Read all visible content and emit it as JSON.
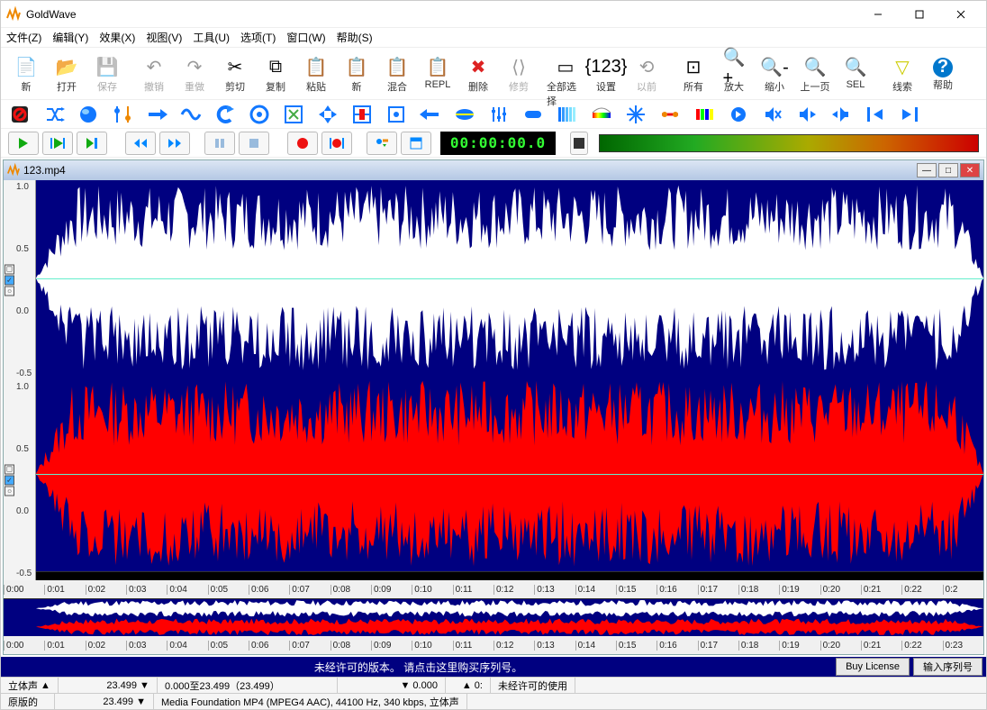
{
  "app": {
    "title": "GoldWave"
  },
  "menu": [
    "文件(Z)",
    "编辑(Y)",
    "效果(X)",
    "视图(V)",
    "工具(U)",
    "选项(T)",
    "窗口(W)",
    "帮助(S)"
  ],
  "toolbar_main": [
    {
      "icon": "new-icon",
      "label": "新"
    },
    {
      "icon": "open-icon",
      "label": "打开"
    },
    {
      "icon": "save-icon",
      "label": "保存",
      "disabled": true
    },
    {
      "sep": true
    },
    {
      "icon": "undo-icon",
      "label": "撤销",
      "disabled": true
    },
    {
      "icon": "redo-icon",
      "label": "重做",
      "disabled": true
    },
    {
      "icon": "cut-icon",
      "label": "剪切"
    },
    {
      "icon": "copy-icon",
      "label": "复制"
    },
    {
      "icon": "paste-icon",
      "label": "粘贴"
    },
    {
      "icon": "pastenew-icon",
      "label": "新"
    },
    {
      "icon": "mix-icon",
      "label": "混合"
    },
    {
      "icon": "repl-icon",
      "label": "REPL"
    },
    {
      "icon": "delete-icon",
      "label": "删除"
    },
    {
      "icon": "trim-icon",
      "label": "修剪",
      "disabled": true
    },
    {
      "sep": true
    },
    {
      "icon": "selall-icon",
      "label": "全部选择"
    },
    {
      "icon": "set-icon",
      "label": "设置"
    },
    {
      "icon": "prev-icon",
      "label": "以前",
      "disabled": true
    },
    {
      "sep": true
    },
    {
      "icon": "all-icon",
      "label": "所有"
    },
    {
      "icon": "zoomin-icon",
      "label": "放大"
    },
    {
      "icon": "zoomout-icon",
      "label": "缩小"
    },
    {
      "icon": "pageback-icon",
      "label": "上一页"
    },
    {
      "icon": "sel-icon",
      "label": "SEL"
    },
    {
      "sep": true
    },
    {
      "icon": "cue-icon",
      "label": "线索"
    },
    {
      "icon": "help-icon",
      "label": "帮助"
    }
  ],
  "playbar": {
    "time": "00:00:00.0"
  },
  "doc": {
    "title": "123.mp4",
    "rulerTop": [
      "0:00",
      "0:01",
      "0:02",
      "0:03",
      "0:04",
      "0:05",
      "0:06",
      "0:07",
      "0:08",
      "0:09",
      "0:10",
      "0:11",
      "0:12",
      "0:13",
      "0:14",
      "0:15",
      "0:16",
      "0:17",
      "0:18",
      "0:19",
      "0:20",
      "0:21",
      "0:22",
      "0:2"
    ],
    "rulerBot": [
      "0:00",
      "0:01",
      "0:02",
      "0:03",
      "0:04",
      "0:05",
      "0:06",
      "0:07",
      "0:08",
      "0:09",
      "0:10",
      "0:11",
      "0:12",
      "0:13",
      "0:14",
      "0:15",
      "0:16",
      "0:17",
      "0:18",
      "0:19",
      "0:20",
      "0:21",
      "0:22",
      "0:23"
    ],
    "scaleL": [
      "1.0",
      "0.5",
      "0.0",
      "-0.5"
    ],
    "scaleR": [
      "1.0",
      "0.5",
      "0.0",
      "-0.5"
    ]
  },
  "license": {
    "message": "未经许可的版本。 请点击这里购买序列号。",
    "buy": "Buy License",
    "enter": "输入序列号"
  },
  "status1": {
    "ch": "立体声",
    "dur": "23.499",
    "range": "0.000至23.499（23.499）",
    "pos": "0.000",
    "zero": "0:",
    "lic": "未经许可的使用"
  },
  "status2": {
    "ver": "原版的",
    "dur": "23.499",
    "fmt": "Media Foundation MP4 (MPEG4 AAC), 44100 Hz, 340 kbps, 立体声"
  }
}
